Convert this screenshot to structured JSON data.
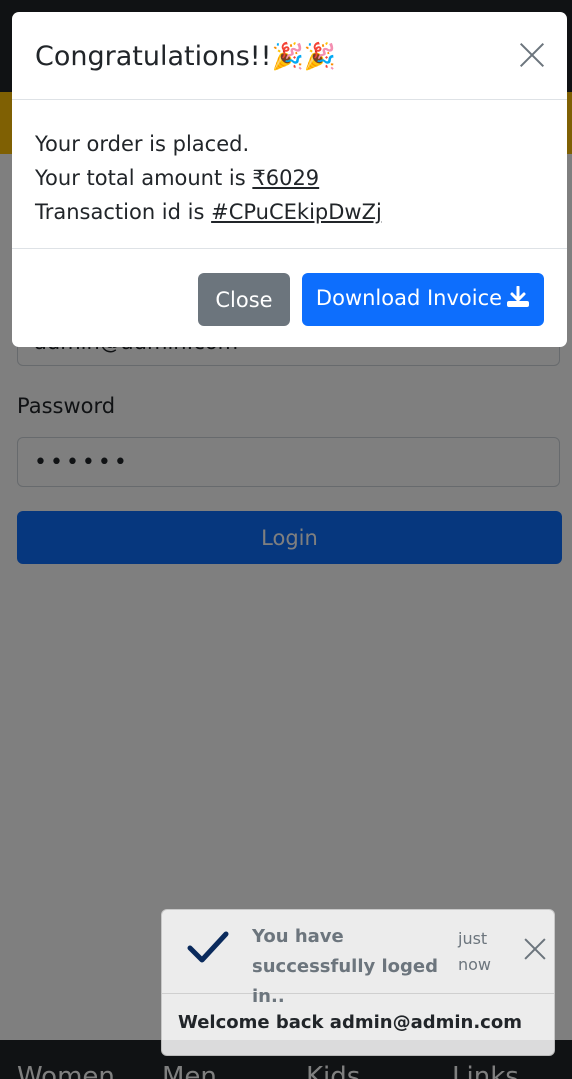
{
  "login_form": {
    "email_value": "admin@admin.com",
    "password_label": "Password",
    "password_value": "••••••",
    "login_label": "Login"
  },
  "footer": {
    "links": [
      "Women",
      "Men",
      "Kids",
      "Links"
    ]
  },
  "modal": {
    "title": "Congratulations!!",
    "title_emoji": "🎉🎉",
    "line1": "Your order is placed.",
    "amount_prefix": "Your total amount is ",
    "amount": "₹6029",
    "transaction_prefix": "Transaction id is ",
    "transaction_id": "#CPuCEkipDwZj",
    "close_label": "Close",
    "download_label": "Download Invoice"
  },
  "toast": {
    "title": "You have successfully loged in..",
    "time": "just now",
    "body": "Welcome back admin@admin.com"
  },
  "colors": {
    "primary": "#0d6efd",
    "secondary": "#6c757d",
    "warning": "#ffc107",
    "dark": "#212529"
  },
  "icons": {
    "modal_close": "close-icon",
    "download": "download-icon",
    "toast_check": "check-icon",
    "toast_close": "close-icon"
  }
}
